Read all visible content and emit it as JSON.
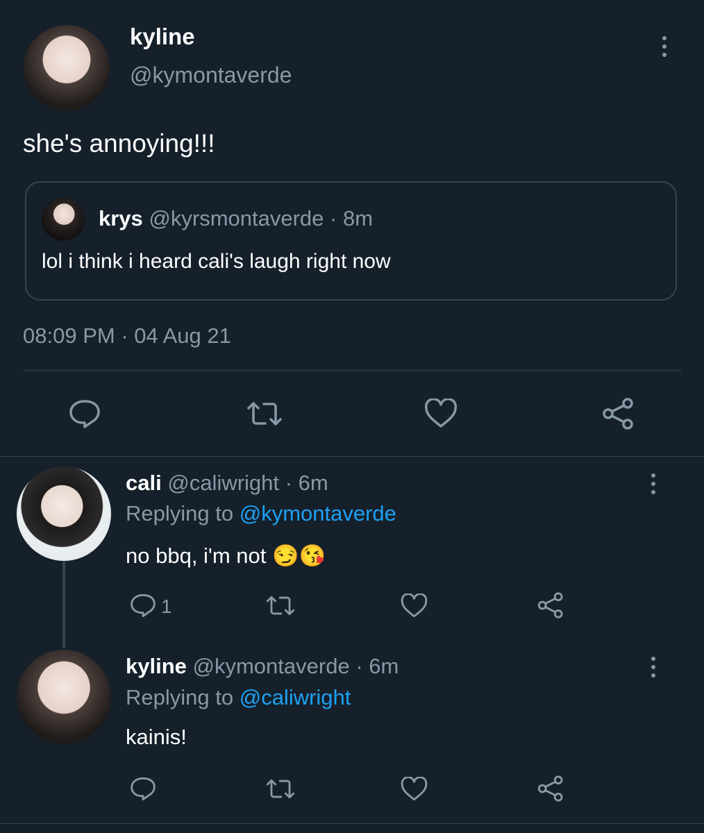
{
  "main_tweet": {
    "display_name": "kyline",
    "handle": "@kymontaverde",
    "text": "she's annoying!!!",
    "timestamp": "08:09 PM · 04 Aug 21",
    "quote": {
      "display_name": "krys",
      "handle": "@kyrsmontaverde",
      "time": "· 8m",
      "text": "lol i think i heard cali's laugh right now"
    },
    "actions": [
      "reply-icon",
      "retweet-icon",
      "like-icon",
      "share-icon"
    ]
  },
  "replies": [
    {
      "display_name": "cali",
      "handle": "@caliwright",
      "time": "· 6m",
      "replying_prefix": "Replying to",
      "replying_to": "@kymontaverde",
      "text": "no bbq, i'm not 😏😘",
      "reply_count": "1"
    },
    {
      "display_name": "kyline",
      "handle": "@kymontaverde",
      "time": "· 6m",
      "replying_prefix": "Replying to",
      "replying_to": "@caliwright",
      "text": "kainis!",
      "reply_count": ""
    }
  ],
  "colors": {
    "background": "#15202b",
    "muted": "#8899a6",
    "link": "#1da1f2",
    "divider": "#38444d"
  }
}
